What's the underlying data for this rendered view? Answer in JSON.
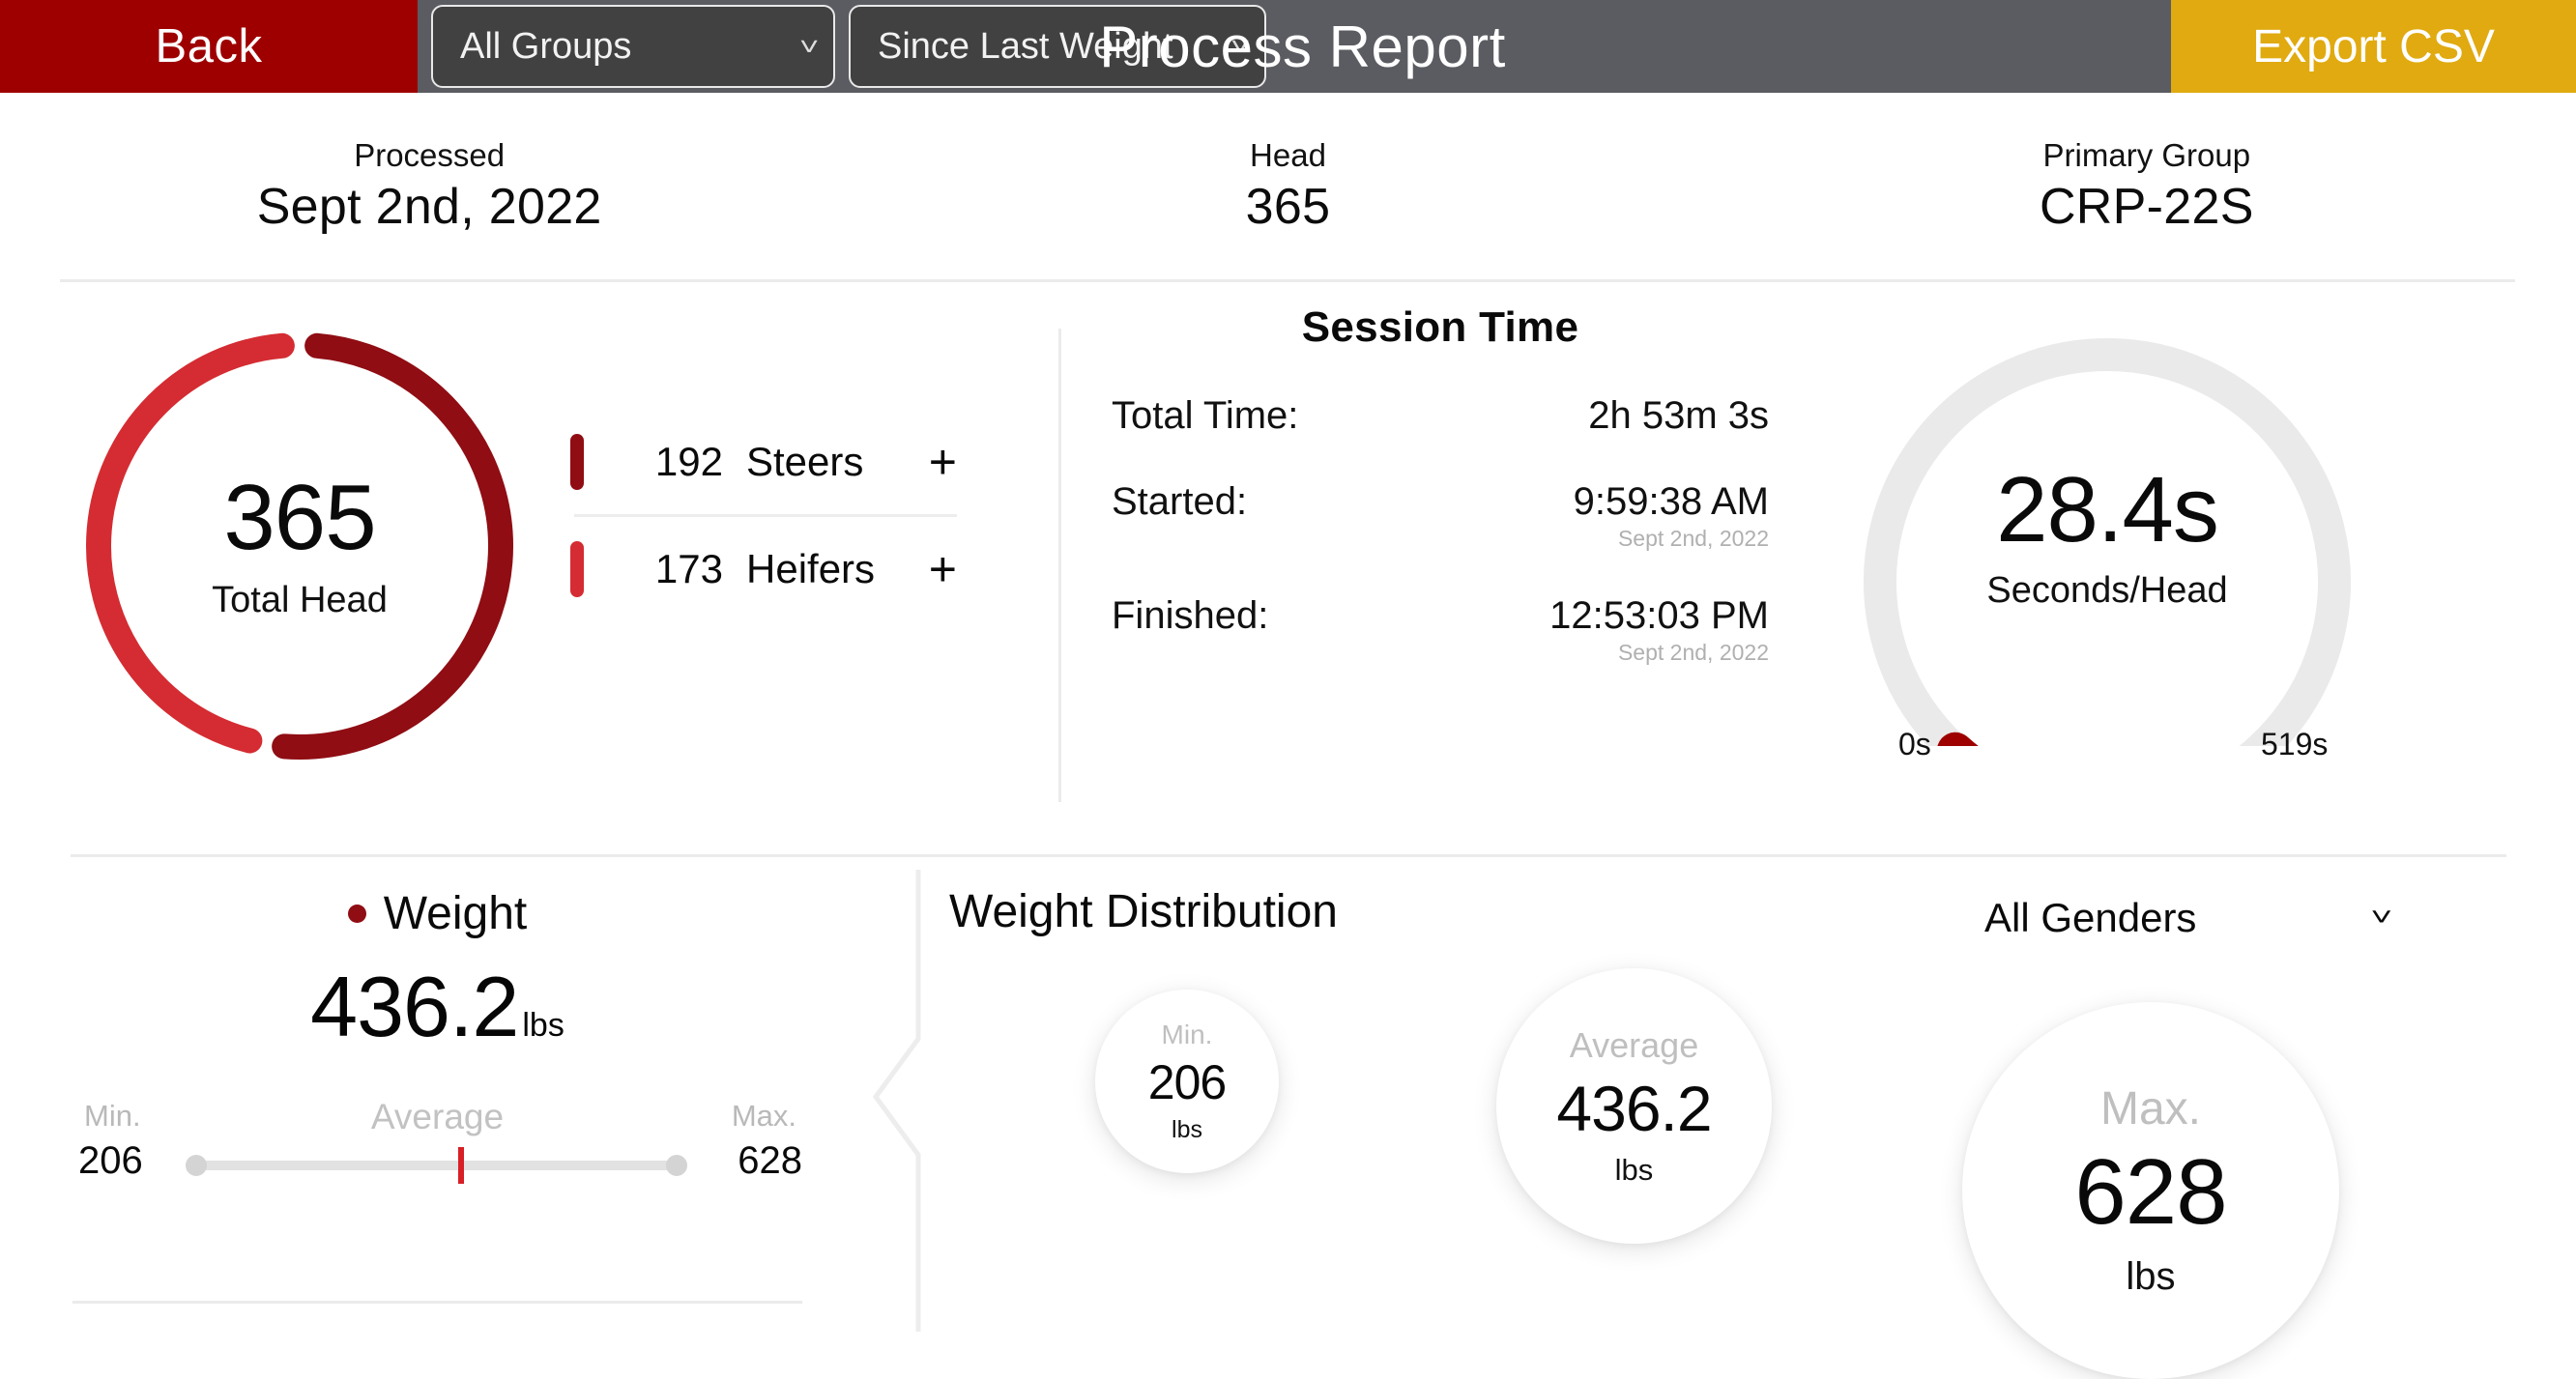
{
  "header": {
    "back_label": "Back",
    "group_filter": "All Groups",
    "date_filter": "Since Last Weight",
    "title": "Process Report",
    "export_label": "Export CSV",
    "bar_color": "#5a5c61",
    "back_color": "#9e0000",
    "export_color": "#e0aa10"
  },
  "summary": {
    "processed_label": "Processed",
    "processed_value": "Sept 2nd, 2022",
    "head_label": "Head",
    "head_value": "365",
    "group_label": "Primary Group",
    "group_value": "CRP-22S"
  },
  "donut": {
    "total": "365",
    "total_label": "Total Head",
    "legend": [
      {
        "count": "192",
        "name": "Steers",
        "color": "#8f0d13",
        "add": "+"
      },
      {
        "count": "173",
        "name": "Heifers",
        "color": "#d42c32",
        "add": "+"
      }
    ]
  },
  "session": {
    "heading": "Session Time",
    "total_key": "Total Time:",
    "total_value": "2h 53m 3s",
    "started_key": "Started:",
    "started_value": "9:59:38 AM",
    "started_date": "Sept 2nd, 2022",
    "finished_key": "Finished:",
    "finished_value": "12:53:03 PM",
    "finished_date": "Sept 2nd, 2022"
  },
  "gauge": {
    "value": "28.4s",
    "label": "Seconds/Head",
    "min_label": "0s",
    "max_label": "519s",
    "track_color": "#eaeaea",
    "indicator_color": "#9e0000"
  },
  "weight": {
    "title": "Weight",
    "dot_color": "#8f0d13",
    "value": "436.2",
    "unit": "lbs",
    "min_label": "Min.",
    "avg_label": "Average",
    "max_label": "Max.",
    "min_value": "206",
    "max_value": "628",
    "marker_color": "#d81f26"
  },
  "distribution": {
    "title": "Weight Distribution",
    "gender_filter": "All Genders",
    "bubbles": [
      {
        "label": "Min.",
        "value": "206",
        "unit": "lbs"
      },
      {
        "label": "Average",
        "value": "436.2",
        "unit": "lbs"
      },
      {
        "label": "Max.",
        "value": "628",
        "unit": "lbs"
      }
    ]
  },
  "chart_data": {
    "type": "pie",
    "title": "Total Head",
    "categories": [
      "Steers",
      "Heifers"
    ],
    "values": [
      192,
      173
    ],
    "total": 365,
    "colors": [
      "#8f0d13",
      "#d42c32"
    ],
    "legend": "right",
    "secondary": {
      "type": "gauge",
      "title": "Seconds/Head",
      "value": 28.4,
      "range": [
        0,
        519
      ],
      "unit": "s"
    },
    "tertiary": {
      "type": "scatter",
      "title": "Weight Distribution",
      "xlabel": "",
      "ylabel": "lbs",
      "points": [
        {
          "label": "Min.",
          "value": 206,
          "unit": "lbs"
        },
        {
          "label": "Average",
          "value": 436.2,
          "unit": "lbs"
        },
        {
          "label": "Max.",
          "value": 628,
          "unit": "lbs"
        }
      ],
      "range": [
        206,
        628
      ]
    }
  }
}
